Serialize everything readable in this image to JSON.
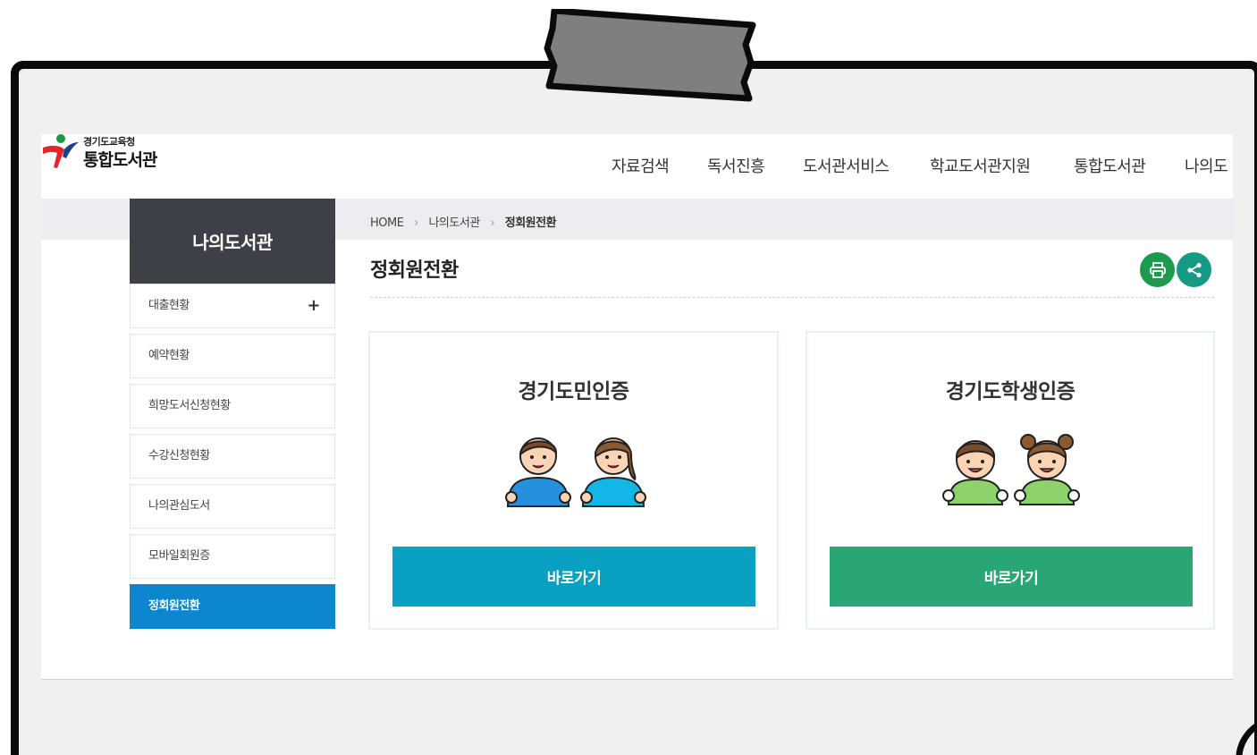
{
  "header": {
    "logo_small": "경기도교육청",
    "logo_big": "통합도서관",
    "nav": [
      "자료검색",
      "독서진흥",
      "도서관서비스",
      "학교도서관지원",
      "통합도서관",
      "나의도"
    ]
  },
  "sidebar": {
    "title": "나의도서관",
    "items": [
      {
        "label": "대출현황",
        "expand": "+"
      },
      {
        "label": "예약현황"
      },
      {
        "label": "희망도서신청현황"
      },
      {
        "label": "수강신청현황"
      },
      {
        "label": "나의관심도서"
      },
      {
        "label": "모바일회원증"
      },
      {
        "label": "정회원전환",
        "active": true
      }
    ]
  },
  "breadcrumb": [
    "HOME",
    "나의도서관",
    "정회원전환"
  ],
  "breadcrumb_sep": "›",
  "page_title": "정회원전환",
  "actions": {
    "print_icon": "printer-icon",
    "share_icon": "share-icon"
  },
  "cards": [
    {
      "title": "경기도민인증",
      "button": "바로가기",
      "button_color": "#0aa0c1",
      "illustration": "adult-citizens-icon"
    },
    {
      "title": "경기도학생인증",
      "button": "바로가기",
      "button_color": "#28a673",
      "illustration": "students-icon"
    }
  ],
  "colors": {
    "sidebar_head": "#3d4046",
    "active_item": "#0b86cf",
    "print": "#1c9a4d",
    "share": "#159a86"
  }
}
